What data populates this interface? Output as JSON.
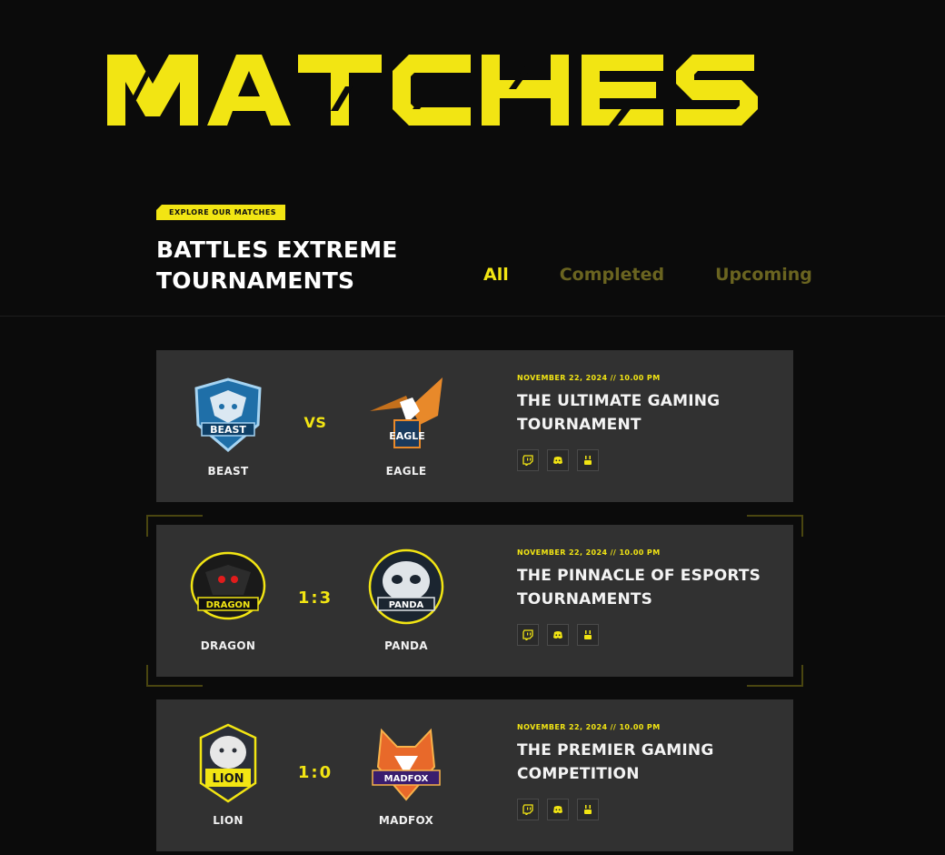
{
  "hero": {
    "title": "MATCHES"
  },
  "section": {
    "tag": "EXPLORE OUR MATCHES",
    "heading_line1": "BATTLES EXTREME",
    "heading_line2": "TOURNAMENTS"
  },
  "tabs": [
    {
      "label": "All",
      "active": true
    },
    {
      "label": "Completed",
      "active": false
    },
    {
      "label": "Upcoming",
      "active": false
    }
  ],
  "matches": [
    {
      "team_a": "BEAST",
      "team_a_icon": "beast-logo",
      "team_b": "EAGLE",
      "team_b_icon": "eagle-logo",
      "score": "VS",
      "date": "NOVEMBER 22, 2024  //  10.00 PM",
      "title_line1": "THE ULTIMATE GAMING",
      "title_line2": "TOURNAMENT"
    },
    {
      "team_a": "DRAGON",
      "team_a_icon": "dragon-logo",
      "team_b": "PANDA",
      "team_b_icon": "panda-logo",
      "score": "1:3",
      "date": "NOVEMBER 22, 2024  //  10.00 PM",
      "title_line1": "THE PINNACLE OF ESPORTS",
      "title_line2": "TOURNAMENTS"
    },
    {
      "team_a": "LION",
      "team_a_icon": "lion-logo",
      "team_b": "MADFOX",
      "team_b_icon": "madfox-logo",
      "score": "1:0",
      "date": "NOVEMBER 22, 2024  //  10.00 PM",
      "title_line1": "THE PREMIER GAMING",
      "title_line2": "COMPETITION"
    }
  ],
  "socials": [
    "twitch-icon",
    "discord-icon",
    "youtube-icon"
  ],
  "colors": {
    "accent": "#f2e513",
    "background": "#0b0b0b",
    "card": "#313131",
    "tab_inactive": "#6a6420"
  }
}
